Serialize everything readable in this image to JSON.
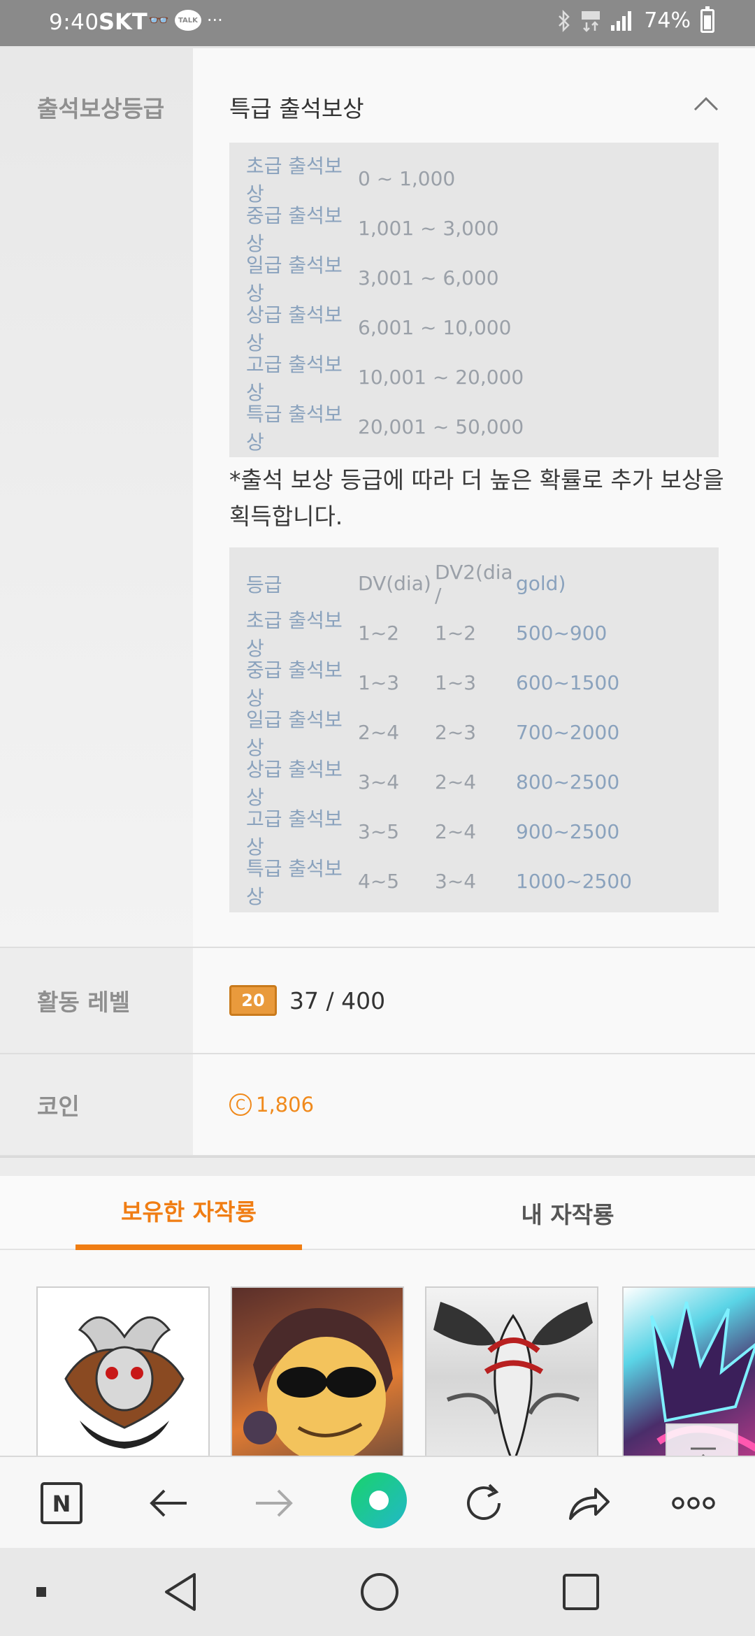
{
  "status_bar": {
    "time": "9:40",
    "carrier": "SKT",
    "extra": "···",
    "talk_label": "TALK",
    "battery_percent": "74%"
  },
  "reward_grade": {
    "label": "출석보상등급",
    "current": "특급 출석보상",
    "grades": [
      {
        "name": "초급 출석보상",
        "range": "0 ~ 1,000"
      },
      {
        "name": "중급 출석보상",
        "range": "1,001 ~ 3,000"
      },
      {
        "name": "일급 출석보상",
        "range": "3,001 ~ 6,000"
      },
      {
        "name": "상급 출석보상",
        "range": "6,001 ~ 10,000"
      },
      {
        "name": "고급 출석보상",
        "range": "10,001 ~ 20,000"
      },
      {
        "name": "특급 출석보상",
        "range": "20,001 ~ 50,000"
      }
    ],
    "note": "*출석 보상 등급에 따라 더 높은 확률로 추가 보상을 획득합니다.",
    "dv_table": {
      "headers": [
        "등급",
        "DV(dia)",
        "DV2(dia /",
        "gold)"
      ],
      "rows": [
        [
          "초급 출석보상",
          "1~2",
          "1~2",
          "500~900"
        ],
        [
          "중급 출석보상",
          "1~3",
          "1~3",
          "600~1500"
        ],
        [
          "일급 출석보상",
          "2~4",
          "2~3",
          "700~2000"
        ],
        [
          "상급 출석보상",
          "3~4",
          "2~4",
          "800~2500"
        ],
        [
          "고급 출석보상",
          "3~5",
          "2~4",
          "900~2500"
        ],
        [
          "특급 출석보상",
          "4~5",
          "3~4",
          "1000~2500"
        ]
      ]
    }
  },
  "activity_level": {
    "label": "활동 레벨",
    "badge": "20",
    "value": "37 / 400"
  },
  "coin": {
    "label": "코인",
    "icon_glyph": "C",
    "value": "1,806"
  },
  "tabs": {
    "owned": "보유한 자작룡",
    "mine": "내 자작룡"
  },
  "browser_bar": {
    "home_glyph": "N"
  },
  "colors": {
    "accent": "#f07d13",
    "grade_name": "#8aa2bd",
    "status_bar": "#8a8a8a"
  }
}
